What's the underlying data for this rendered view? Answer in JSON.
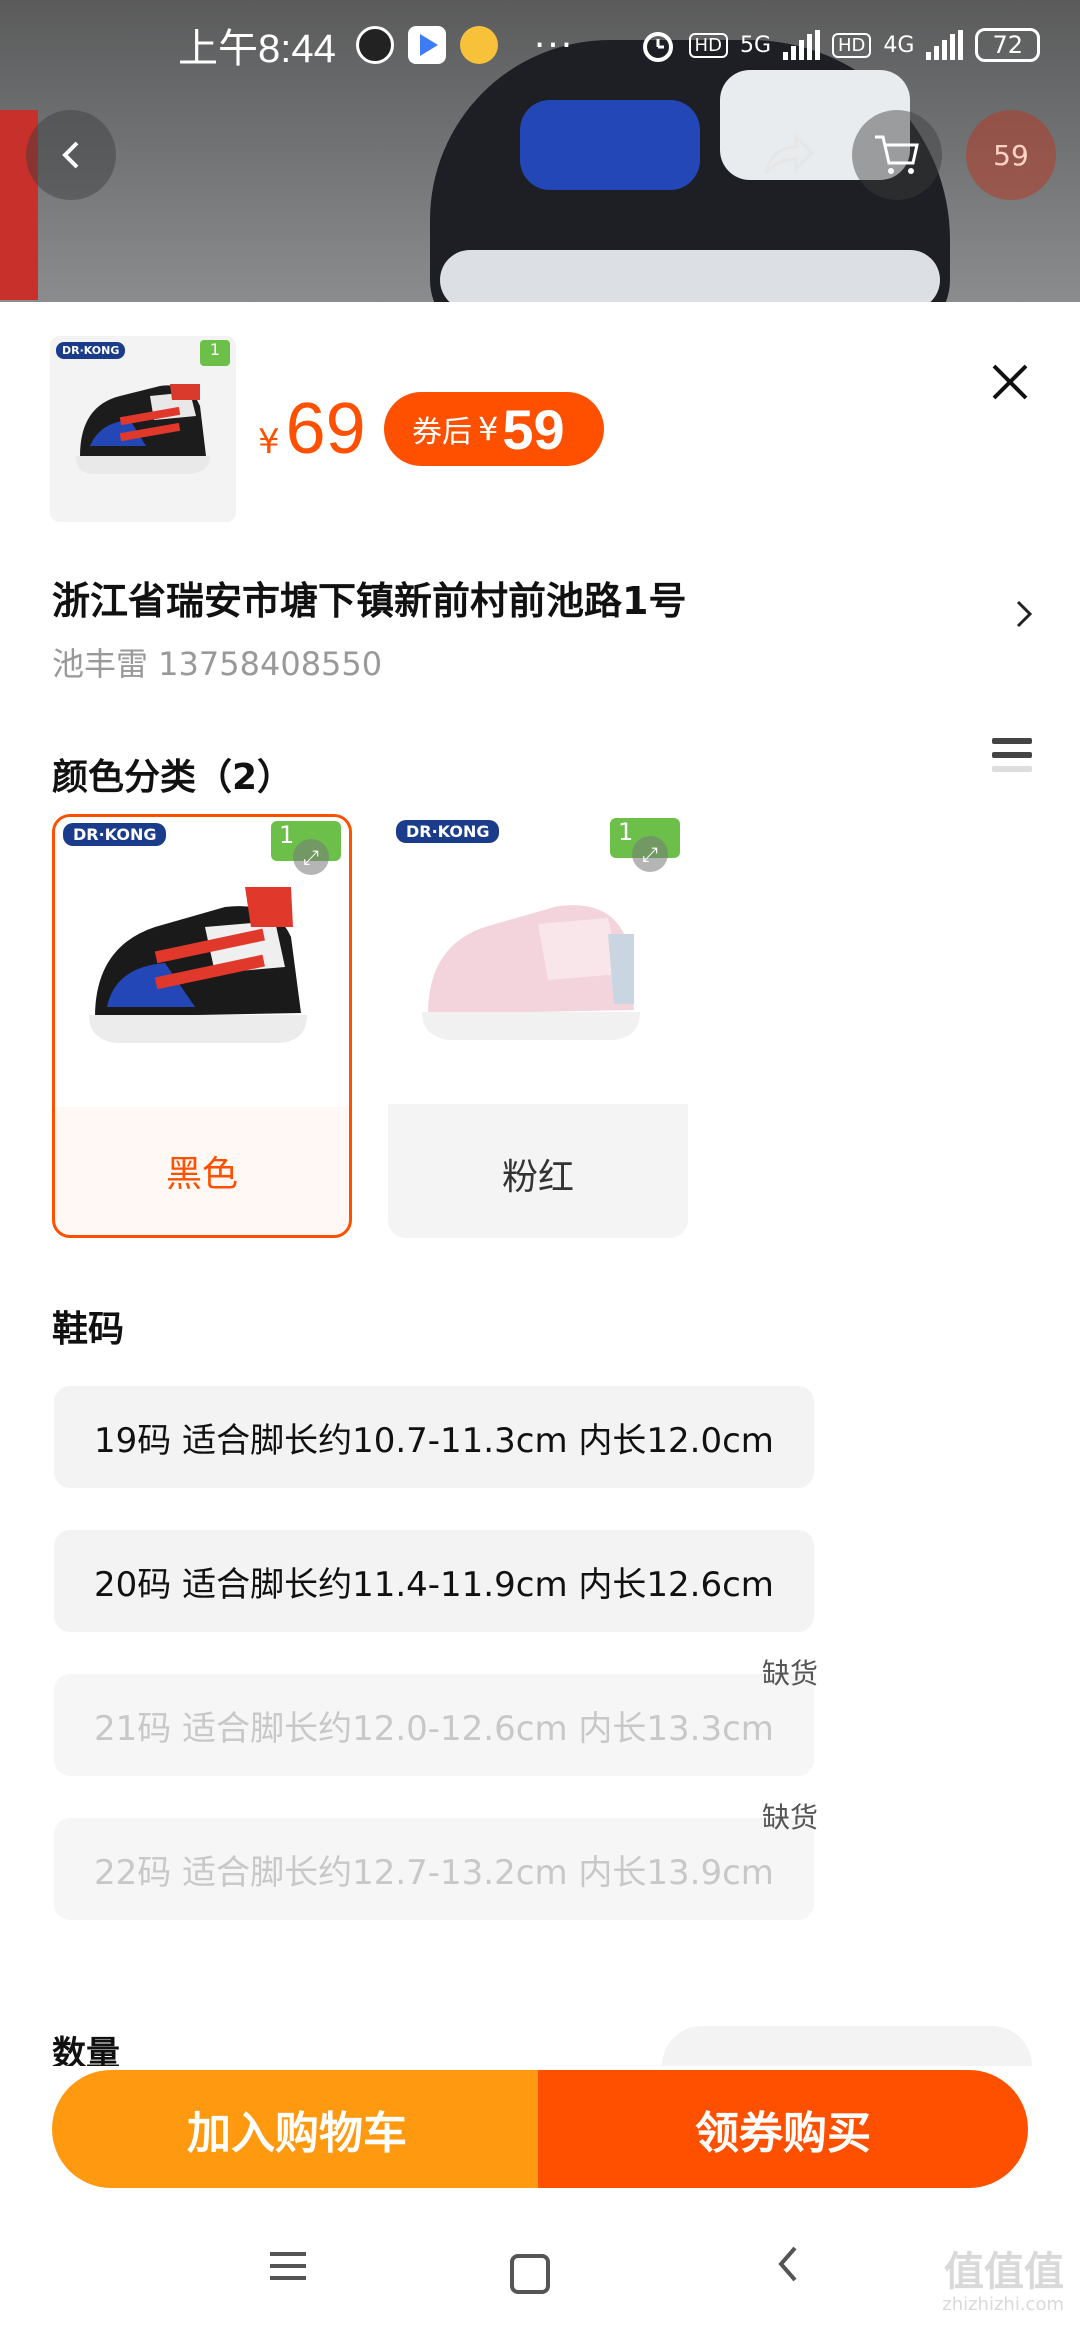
{
  "status_bar": {
    "time": "上午8:44",
    "more": "···",
    "net1_hd": "HD",
    "net1_type": "5G",
    "net2_hd": "HD",
    "net2_type": "4G",
    "battery": "72"
  },
  "header": {
    "cart_count": "59"
  },
  "product": {
    "price_symbol": "¥",
    "price": "69",
    "coupon_label": "券后",
    "coupon_symbol": "¥",
    "coupon_price": "59",
    "brand": "DR·KONG",
    "badge": "1"
  },
  "address": {
    "line": "浙江省瑞安市塘下镇新前村前池路1号",
    "contact": "池丰雷 13758408550"
  },
  "color_section": {
    "title": "颜色分类（2）",
    "options": [
      {
        "name": "黑色",
        "selected": true
      },
      {
        "name": "粉红",
        "selected": false
      }
    ]
  },
  "size_section": {
    "title": "鞋码",
    "options": [
      {
        "label": "19码  适合脚长约10.7-11.3cm  内长12.0cm",
        "available": true
      },
      {
        "label": "20码  适合脚长约11.4-11.9cm  内长12.6cm",
        "available": true
      },
      {
        "label": "21码  适合脚长约12.0-12.6cm  内长13.3cm",
        "available": false,
        "tag": "缺货"
      },
      {
        "label": "22码  适合脚长约12.7-13.2cm  内长13.9cm",
        "available": false,
        "tag": "缺货"
      }
    ]
  },
  "quantity": {
    "label": "数量"
  },
  "actions": {
    "add_to_cart": "加入购物车",
    "buy_with_coupon": "领券购买"
  },
  "watermark": {
    "main": "值值值",
    "sub": "zhizhizhi.com"
  }
}
